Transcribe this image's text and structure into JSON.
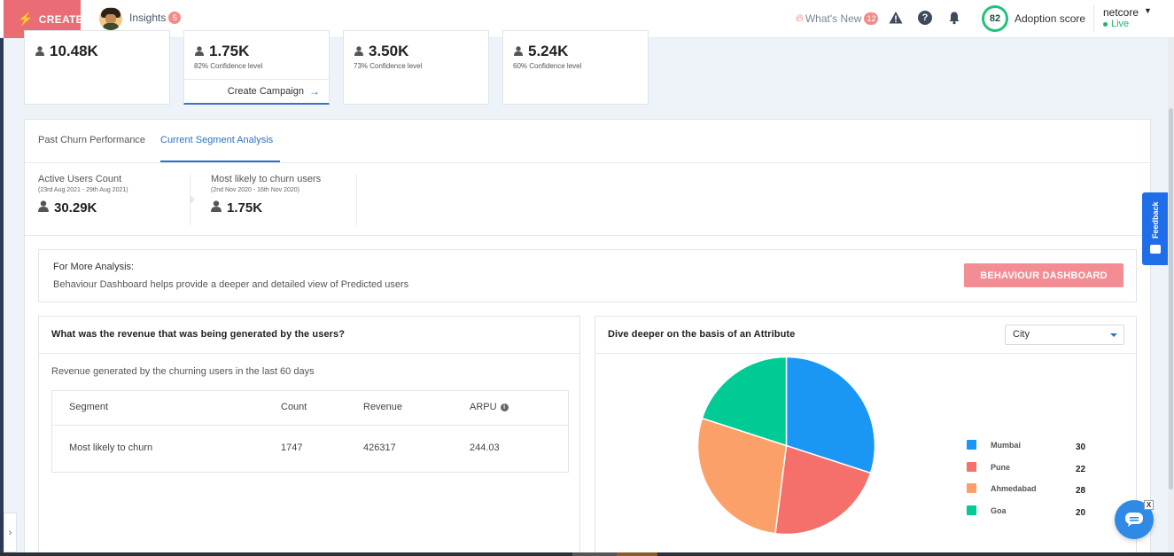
{
  "topbar": {
    "create_label": "CREATE",
    "insights_label": "Insights",
    "insights_count": "5",
    "whats_new_label": "What's New",
    "whats_new_count": "12",
    "adoption_score": "82",
    "adoption_label": "Adoption score",
    "account_name": "netcore",
    "account_status": "Live"
  },
  "stat_cards": [
    {
      "value": "10.48K",
      "sub": ""
    },
    {
      "value": "1.75K",
      "sub": "82% Confidence level",
      "action": "Create Campaign"
    },
    {
      "value": "3.50K",
      "sub": "73% Confidence level"
    },
    {
      "value": "5.24K",
      "sub": "60% Confidence level"
    }
  ],
  "tabs": [
    {
      "label": "Past Churn Performance"
    },
    {
      "label": "Current Segment Analysis"
    }
  ],
  "metrics": [
    {
      "label": "Active Users Count",
      "range": "(23rd Aug 2021 - 29th Aug 2021)",
      "value": "30.29K"
    },
    {
      "label": "Most likely to churn users",
      "range": "(2nd Nov 2020 - 16th Nov 2020)",
      "value": "1.75K"
    }
  ],
  "analysis": {
    "title": "For More Analysis:",
    "description": "Behaviour Dashboard helps provide a deeper and detailed view of Predicted users",
    "button_label": "BEHAVIOUR DASHBOARD"
  },
  "revenue": {
    "title": "What was the revenue that was being generated by the users?",
    "subtitle": "Revenue generated by the churning users in the last 60 days",
    "columns": [
      "Segment",
      "Count",
      "Revenue",
      "ARPU"
    ],
    "rows": [
      [
        "Most likely to churn",
        "1747",
        "426317",
        "244.03"
      ]
    ]
  },
  "attribute": {
    "title": "Dive deeper on the basis of an Attribute",
    "selected": "City"
  },
  "feedback_label": "Feedback",
  "chart_data": {
    "type": "pie",
    "categories": [
      "Mumbai",
      "Pune",
      "Ahmedabad",
      "Goa"
    ],
    "values": [
      30,
      22,
      28,
      20
    ],
    "colors": [
      "#1a97f5",
      "#f6706b",
      "#fca06a",
      "#00cb95"
    ]
  }
}
